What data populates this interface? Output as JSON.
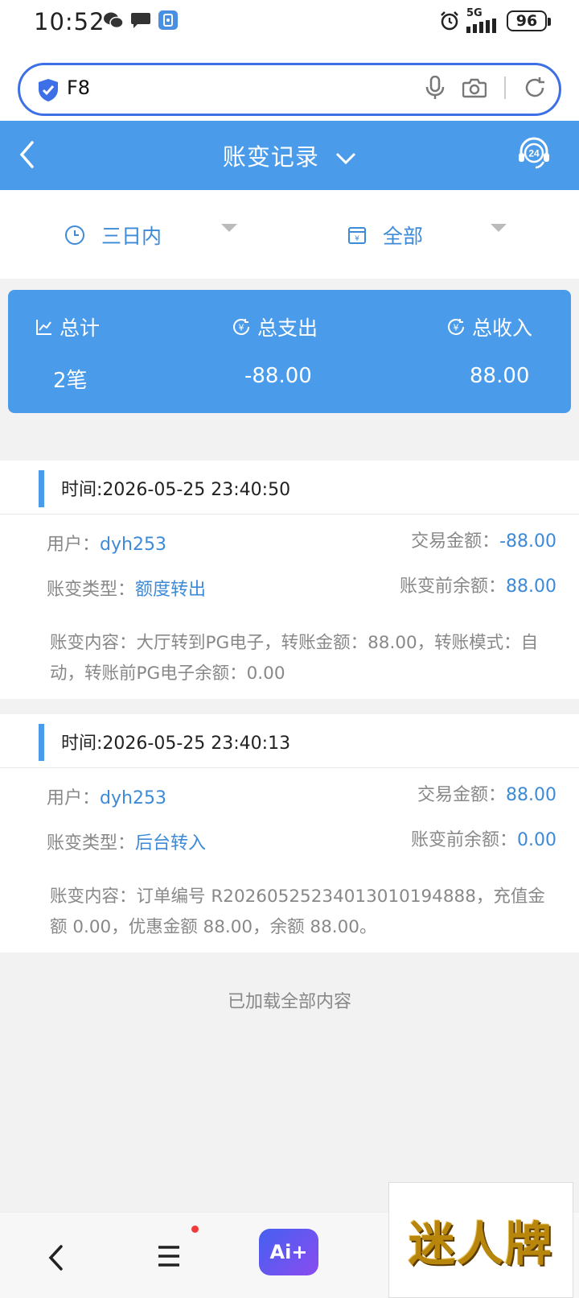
{
  "status_bar": {
    "time": "10:52",
    "network": "5G",
    "battery": "96"
  },
  "browser": {
    "url_text": "F8"
  },
  "nav": {
    "title": "账变记录"
  },
  "filters": {
    "period": "三日内",
    "category": "全部"
  },
  "summary": {
    "total_label": "总计",
    "total_value": "2笔",
    "expense_label": "总支出",
    "expense_value": "-88.00",
    "income_label": "总收入",
    "income_value": "88.00"
  },
  "records": [
    {
      "time": "时间:2026-05-25 23:40:50",
      "user_label": "用户：",
      "user": "dyh253",
      "type_label": "账变类型：",
      "type": "额度转出",
      "amount_label": "交易金额：",
      "amount": "-88.00",
      "balance_label": "账变前余额：",
      "balance": "88.00",
      "content": "账变内容：大厅转到PG电子，转账金额：88.00，转账模式：自动，转账前PG电子余额：0.00"
    },
    {
      "time": "时间:2026-05-25 23:40:13",
      "user_label": "用户：",
      "user": "dyh253",
      "type_label": "账变类型：",
      "type": "后台转入",
      "amount_label": "交易金额：",
      "amount": "88.00",
      "balance_label": "账变前余额：",
      "balance": "0.00",
      "content": "账变内容：订单编号 R20260525234013010194888，充值金额 0.00，优惠金额 88.00，余额 88.00。"
    }
  ],
  "footer_text": "已加载全部内容",
  "bottom_bar": {
    "ai_label": "Ai+"
  },
  "ad": {
    "text": "迷人牌"
  },
  "colors": {
    "primary": "#4a9be9",
    "link": "#3d8ad8",
    "url_border": "#3d6fe6"
  }
}
